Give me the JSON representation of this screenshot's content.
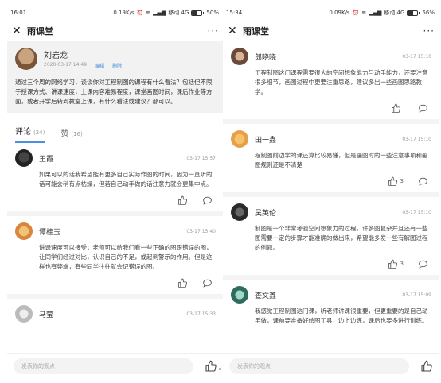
{
  "left": {
    "status": {
      "time": "16:01",
      "net": "0.19K/s",
      "carrier": "移动 4G",
      "battery_text": "50%",
      "battery_level": 0.5
    },
    "nav": {
      "title": "雨课堂"
    },
    "post": {
      "author": "刘岩龙",
      "date": "2020-03-17 14:49",
      "edit": "编辑",
      "delete": "删除",
      "body": "通过三个周的网络学习，谈谈你对工程制图的课程有什么看法？包括但不限于授课方式、讲课速度，上课内容难易程度，课堂画图时间，课后作业等方面，或者开学后转到教室上课，有什么看法或建议？都可以。"
    },
    "tabs": [
      {
        "label": "评论",
        "count": "(24)"
      },
      {
        "label": "赞",
        "count": "(16)"
      }
    ],
    "comments": [
      {
        "name": "王霞",
        "time": "03-17 15:57",
        "body": "如果可以的话我希望能有更多自己实际作图的时间，因为一直听的话可能会稍有点枯燥，但若自己动手做的话注意力就会更集中点。"
      },
      {
        "name": "谭桂玉",
        "time": "03-17 15:40",
        "body": "讲课速度可以接受；老师可以给我们看一些正确的图跟错误的图，让同学们经过对比，认识自己的不足，或起到警示的作用。但是这样也有弊端，有些同学往往就会记错误的图。"
      },
      {
        "name": "马莹",
        "time": "03-17 15:33",
        "body": ""
      }
    ],
    "input_placeholder": "发表你的观点"
  },
  "right": {
    "status": {
      "time": "15:34",
      "net": "0.09K/s",
      "carrier": "移动 4G",
      "battery_text": "56%",
      "battery_level": 0.56
    },
    "nav": {
      "title": "雨课堂"
    },
    "comments": [
      {
        "name": "郎晓晓",
        "time": "03-17 15:10",
        "body": "工程制图这门课程需要很大的空间想象能力与动手能力，还要注意很多细节，画图过程中更要注重思路，建议多出一些画图思路教学。",
        "likes": ""
      },
      {
        "name": "田一鑫",
        "time": "03-17 15:10",
        "body": "程制图前边学的课还算比较易懂，但是画图时的一些注意事项和画图规则还是不清楚",
        "likes": "3"
      },
      {
        "name": "吴英伦",
        "time": "03-17 15:10",
        "body": "制图是一个非常考验空间想象力的过程，许多图复杂并且还有一些图需要一定的步骤才能准确的做出来，希望能多发一些有解图过程的例题。",
        "likes": "3"
      },
      {
        "name": "查文鑫",
        "time": "03-17 15:09",
        "body": "我感觉工程制图这门课，听老师讲课很重要，但更重要的是自己动手做，课前要准备好绘图工具，边上边练，课后也要多进行训练。",
        "likes": ""
      }
    ],
    "input_placeholder": "发表你的观点"
  },
  "colors": {
    "accent": "#4a90e2",
    "post_bg": "#f2f2f2"
  }
}
